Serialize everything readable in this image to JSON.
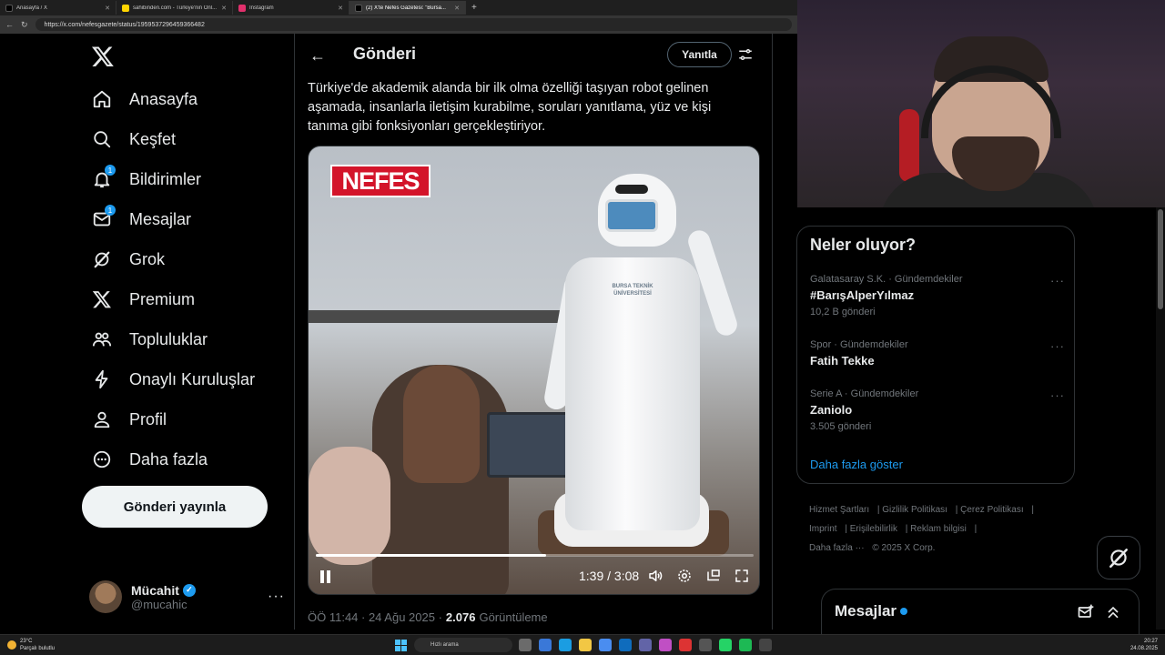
{
  "browser": {
    "tabs": [
      {
        "label": "Anasayfa / X",
        "color": "#000000",
        "active": false
      },
      {
        "label": "sahibinden.com - Türkiye'nin Onl...",
        "color": "#ffd500",
        "active": false
      },
      {
        "label": "Instagram",
        "color": "#e1306c",
        "active": false
      },
      {
        "label": "(2) X'te Nefes Gazetesi: \"Bursa...",
        "color": "#000000",
        "active": true
      }
    ],
    "url": "https://x.com/nefesgazete/status/1959537296459366482"
  },
  "sidebar": {
    "items": [
      {
        "label": "Anasayfa",
        "icon": "home-icon",
        "badge": ""
      },
      {
        "label": "Keşfet",
        "icon": "search-icon",
        "badge": ""
      },
      {
        "label": "Bildirimler",
        "icon": "bell-icon",
        "badge": "1"
      },
      {
        "label": "Mesajlar",
        "icon": "mail-icon",
        "badge": "1"
      },
      {
        "label": "Grok",
        "icon": "grok-icon",
        "badge": ""
      },
      {
        "label": "Premium",
        "icon": "x-logo-icon",
        "badge": ""
      },
      {
        "label": "Topluluklar",
        "icon": "people-icon",
        "badge": ""
      },
      {
        "label": "Onaylı Kuruluşlar",
        "icon": "lightning-icon",
        "badge": ""
      },
      {
        "label": "Profil",
        "icon": "person-icon",
        "badge": ""
      },
      {
        "label": "Daha fazla",
        "icon": "more-circle-icon",
        "badge": ""
      }
    ],
    "post_button": "Gönderi yayınla",
    "account": {
      "name": "Mücahit",
      "handle": "@mucahic"
    }
  },
  "main": {
    "header_title": "Gönderi",
    "reply_button": "Yanıtla",
    "tweet_text": "Türkiye'de akademik alanda bir ilk olma özelliği taşıyan robot gelinen aşamada, insanlarla iletişim kurabilme, soruları yanıtlama, yüz ve kişi tanıma gibi fonksiyonları gerçekleştiriyor.",
    "video": {
      "watermark": "NEFES",
      "robot_label": "BURSA TEKNİK ÜNİVERSİTESİ",
      "time": "1:39 / 3:08",
      "progress": 0.527
    },
    "meta": {
      "time": "ÖÖ 11:44 · 24 Ağu 2025 · ",
      "views": "2.076",
      "views_label": "Görüntüleme"
    }
  },
  "trends": {
    "title": "Neler oluyor?",
    "items": [
      {
        "category": "Galatasaray S.K. · Gündemdekiler",
        "name": "#BarışAlperYılmaz",
        "count": "10,2 B gönderi"
      },
      {
        "category": "Spor · Gündemdekiler",
        "name": "Fatih Tekke",
        "count": ""
      },
      {
        "category": "Serie A · Gündemdekiler",
        "name": "Zaniolo",
        "count": "3.505 gönderi"
      }
    ],
    "show_more": "Daha fazla göster"
  },
  "footer": {
    "links": [
      "Hizmet Şartları",
      "Gizlilik Politikası",
      "Çerez Politikası",
      "Imprint",
      "Erişilebilirlik",
      "Reklam bilgisi",
      "Daha fazla ···",
      "© 2025 X Corp."
    ]
  },
  "messages_drawer": {
    "title": "Mesajlar"
  },
  "taskbar": {
    "weather_temp": "23°C",
    "weather_desc": "Parçalı bulutlu",
    "search_placeholder": "Hızlı arama",
    "time": "20:27",
    "date": "24.08.2025"
  }
}
